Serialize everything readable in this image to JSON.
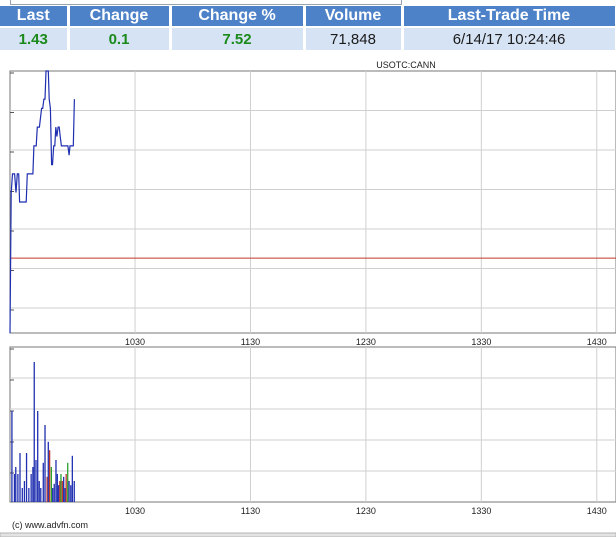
{
  "quote": {
    "headers": [
      "Last",
      "Change",
      "Change %",
      "Volume",
      "Last-Trade Time"
    ],
    "values": [
      "1.43",
      "0.1",
      "7.52",
      "71,848",
      "6/14/17 10:24:46"
    ],
    "up_color": "#1b8a1b",
    "header_color": "#4e82c8"
  },
  "footer": {
    "copyright": "(c) www.advfn.com"
  },
  "chart_data": [
    {
      "type": "line",
      "title": "USOTC:CANN",
      "x_tick_labels": [
        "1030",
        "1130",
        "1230",
        "1330",
        "1430"
      ],
      "x_tick_minutes": [
        630,
        690,
        750,
        810,
        870
      ],
      "xlim_minutes": [
        565,
        880
      ],
      "ylim": [
        1.25,
        1.53
      ],
      "grid": true,
      "reference_line": {
        "value": 1.33,
        "color": "#c0392b"
      },
      "series": [
        {
          "color": "#1f2fb0",
          "points": [
            [
              565.0,
              1.25
            ],
            [
              565.6,
              1.4
            ],
            [
              566.3,
              1.42
            ],
            [
              567.4,
              1.42
            ],
            [
              568.1,
              1.4
            ],
            [
              568.8,
              1.42
            ],
            [
              569.5,
              1.42
            ],
            [
              570.0,
              1.39
            ],
            [
              571.7,
              1.39
            ],
            [
              572.3,
              1.39
            ],
            [
              573.4,
              1.39
            ],
            [
              574.0,
              1.42
            ],
            [
              575.7,
              1.42
            ],
            [
              576.9,
              1.42
            ],
            [
              577.4,
              1.45
            ],
            [
              578.6,
              1.45
            ],
            [
              579.2,
              1.47
            ],
            [
              580.3,
              1.47
            ],
            [
              581.4,
              1.49
            ],
            [
              582.0,
              1.49
            ],
            [
              582.6,
              1.5
            ],
            [
              583.2,
              1.5
            ],
            [
              583.7,
              1.53
            ],
            [
              584.9,
              1.53
            ],
            [
              585.4,
              1.5
            ],
            [
              586.0,
              1.49
            ],
            [
              586.6,
              1.43
            ],
            [
              587.1,
              1.43
            ],
            [
              587.7,
              1.45
            ],
            [
              588.3,
              1.45
            ],
            [
              588.8,
              1.47
            ],
            [
              589.4,
              1.46
            ],
            [
              590.0,
              1.47
            ],
            [
              590.6,
              1.47
            ],
            [
              591.1,
              1.46
            ],
            [
              591.7,
              1.45
            ],
            [
              592.8,
              1.45
            ],
            [
              593.4,
              1.45
            ],
            [
              594.5,
              1.45
            ],
            [
              595.1,
              1.45
            ],
            [
              595.7,
              1.44
            ],
            [
              596.2,
              1.45
            ],
            [
              597.9,
              1.45
            ],
            [
              598.5,
              1.5
            ]
          ]
        }
      ]
    },
    {
      "type": "bar",
      "title": "",
      "x_tick_labels": [
        "1030",
        "1130",
        "1230",
        "1330",
        "1430"
      ],
      "x_tick_minutes": [
        630,
        690,
        750,
        810,
        870
      ],
      "xlim_minutes": [
        565,
        880
      ],
      "grid": true,
      "bars": [
        {
          "x": 566.0,
          "value": 65,
          "color": "#1f2fb0"
        },
        {
          "x": 567.3,
          "value": 20,
          "color": "#1f2fb0"
        },
        {
          "x": 568.0,
          "value": 25,
          "color": "#1f2fb0"
        },
        {
          "x": 569.1,
          "value": 20,
          "color": "#1f2fb0"
        },
        {
          "x": 570.2,
          "value": 35,
          "color": "#1f2fb0"
        },
        {
          "x": 571.4,
          "value": 10,
          "color": "#1f2fb0"
        },
        {
          "x": 572.5,
          "value": 15,
          "color": "#1f2fb0"
        },
        {
          "x": 573.6,
          "value": 35,
          "color": "#1f2fb0"
        },
        {
          "x": 574.8,
          "value": 10,
          "color": "#1f2fb0"
        },
        {
          "x": 576.0,
          "value": 20,
          "color": "#1f2fb0"
        },
        {
          "x": 576.9,
          "value": 25,
          "color": "#1f2fb0"
        },
        {
          "x": 577.6,
          "value": 100,
          "color": "#1f2fb0"
        },
        {
          "x": 578.5,
          "value": 30,
          "color": "#1f2fb0"
        },
        {
          "x": 579.4,
          "value": 65,
          "color": "#1f2fb0"
        },
        {
          "x": 580.2,
          "value": 15,
          "color": "#1f2fb0"
        },
        {
          "x": 581.0,
          "value": 10,
          "color": "#1f2fb0"
        },
        {
          "x": 582.3,
          "value": 28,
          "color": "#1f2fb0"
        },
        {
          "x": 583.2,
          "value": 55,
          "color": "#1f2fb0"
        },
        {
          "x": 584.3,
          "value": 18,
          "color": "#c0392b"
        },
        {
          "x": 584.9,
          "value": 43,
          "color": "#1f2fb0"
        },
        {
          "x": 585.6,
          "value": 37,
          "color": "#c0392b"
        },
        {
          "x": 586.5,
          "value": 25,
          "color": "#2aa02a"
        },
        {
          "x": 587.2,
          "value": 10,
          "color": "#1f2fb0"
        },
        {
          "x": 588.0,
          "value": 13,
          "color": "#1f2fb0"
        },
        {
          "x": 588.9,
          "value": 30,
          "color": "#1f2fb0"
        },
        {
          "x": 589.6,
          "value": 20,
          "color": "#1f2fb0"
        },
        {
          "x": 590.3,
          "value": 12,
          "color": "#1f2fb0"
        },
        {
          "x": 590.9,
          "value": 15,
          "color": "#c0392b"
        },
        {
          "x": 591.5,
          "value": 20,
          "color": "#2aa02a"
        },
        {
          "x": 592.2,
          "value": 15,
          "color": "#c0392b"
        },
        {
          "x": 592.9,
          "value": 18,
          "color": "#1f2fb0"
        },
        {
          "x": 593.6,
          "value": 10,
          "color": "#1f2fb0"
        },
        {
          "x": 594.2,
          "value": 20,
          "color": "#c0392b"
        },
        {
          "x": 595.0,
          "value": 28,
          "color": "#2aa02a"
        },
        {
          "x": 595.7,
          "value": 15,
          "color": "#1f2fb0"
        },
        {
          "x": 596.6,
          "value": 12,
          "color": "#1f2fb0"
        },
        {
          "x": 597.4,
          "value": 33,
          "color": "#1f2fb0"
        },
        {
          "x": 598.4,
          "value": 15,
          "color": "#1f2fb0"
        }
      ]
    }
  ]
}
